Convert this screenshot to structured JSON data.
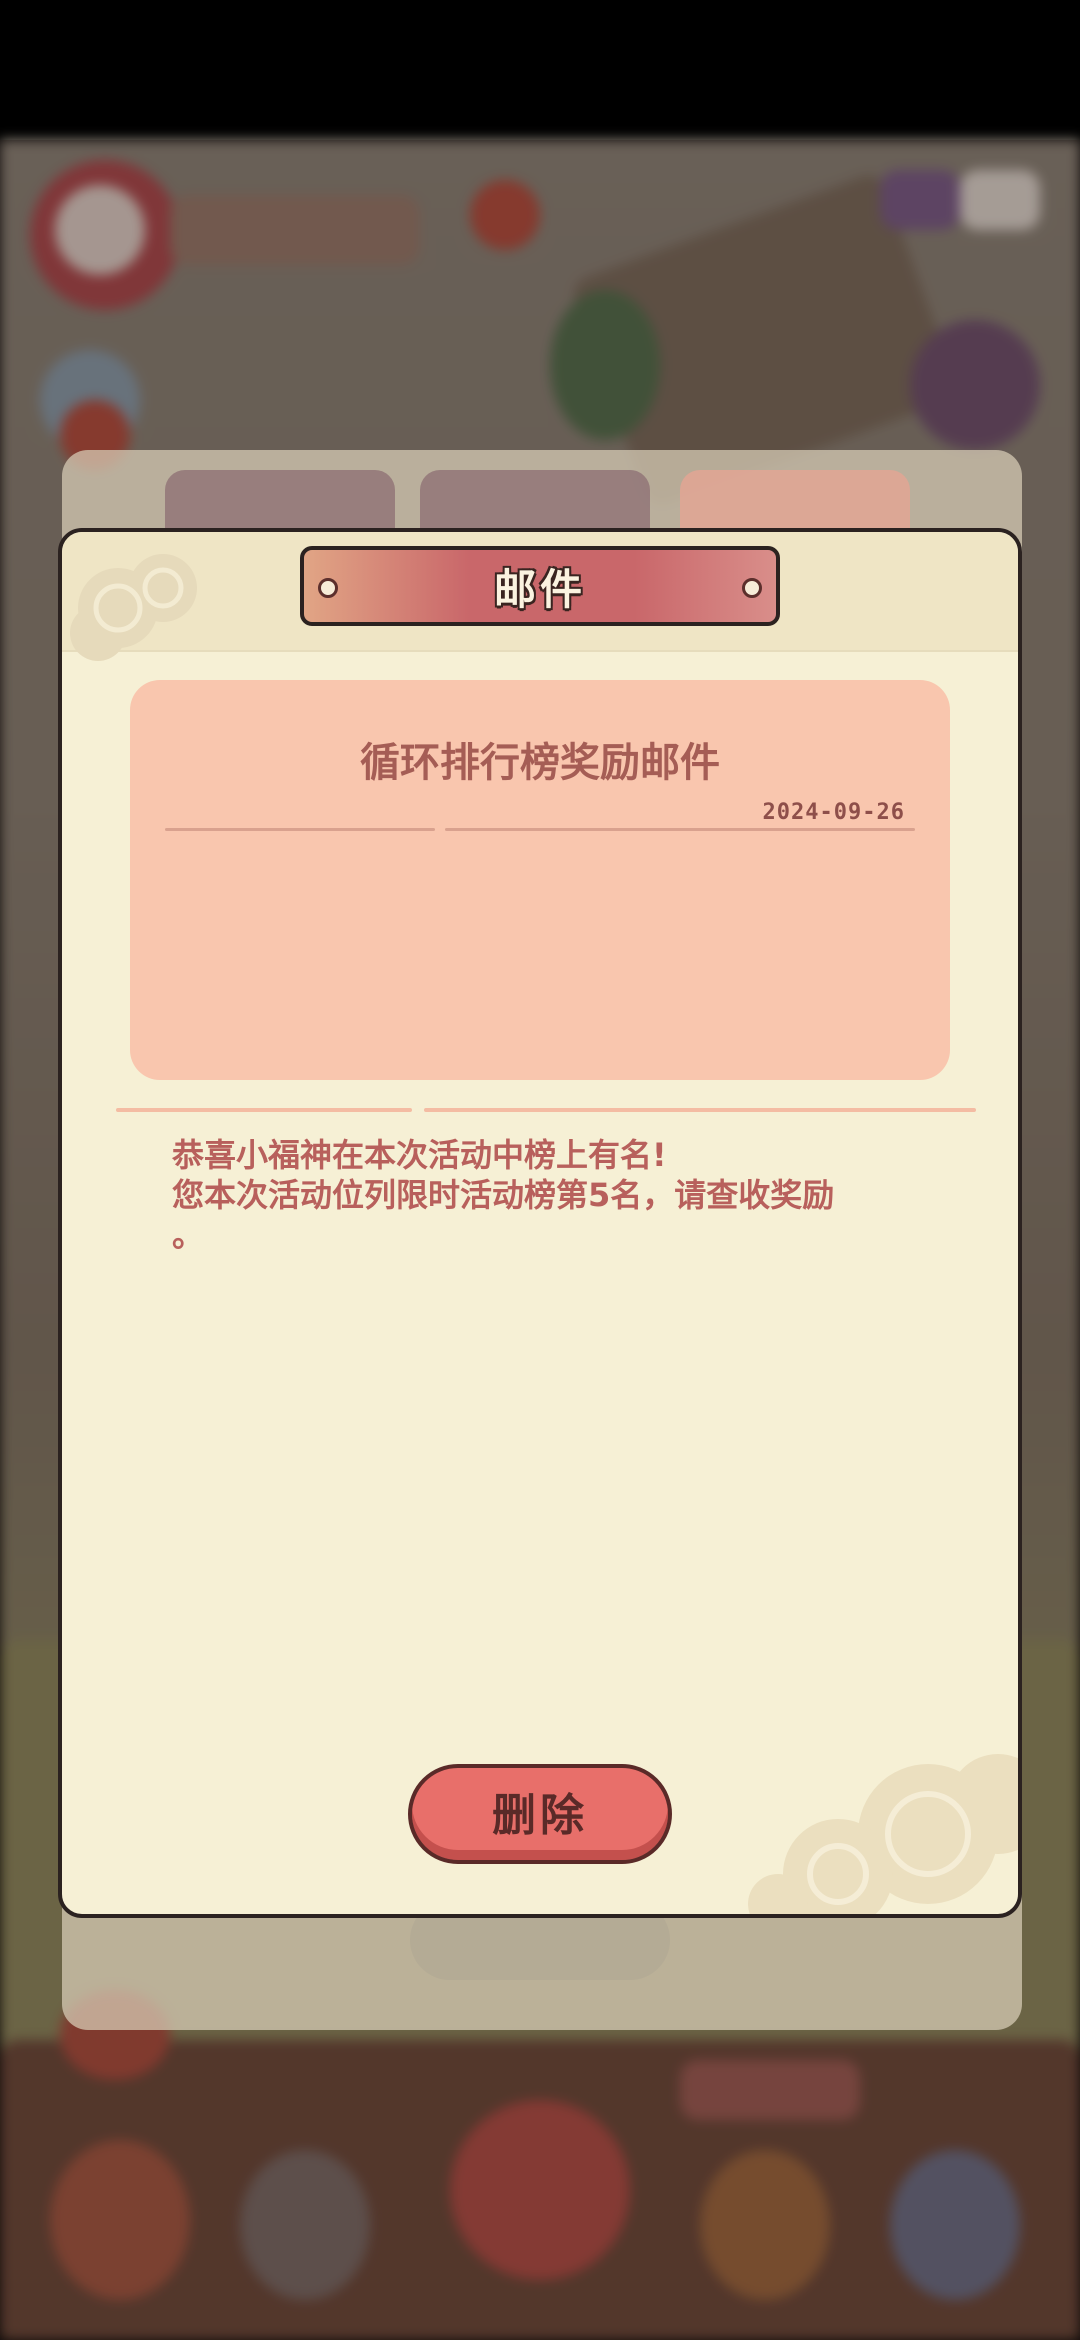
{
  "dialog": {
    "title": "邮件",
    "mail": {
      "subject": "循环排行榜奖励邮件",
      "date": "2024-09-26",
      "body_lines": [
        "恭喜小福神在本次活动中榜上有名!",
        "您本次活动位列限时活动榜第5名，请查收奖励",
        "。"
      ]
    },
    "delete_button": "删除"
  },
  "colors": {
    "dialog_bg": "#f6f0d5",
    "card_bg": "#f9c6ae",
    "text_accent": "#b8605c",
    "delete_button_bg": "#e86f6a",
    "title_plate": "#c9676a"
  }
}
